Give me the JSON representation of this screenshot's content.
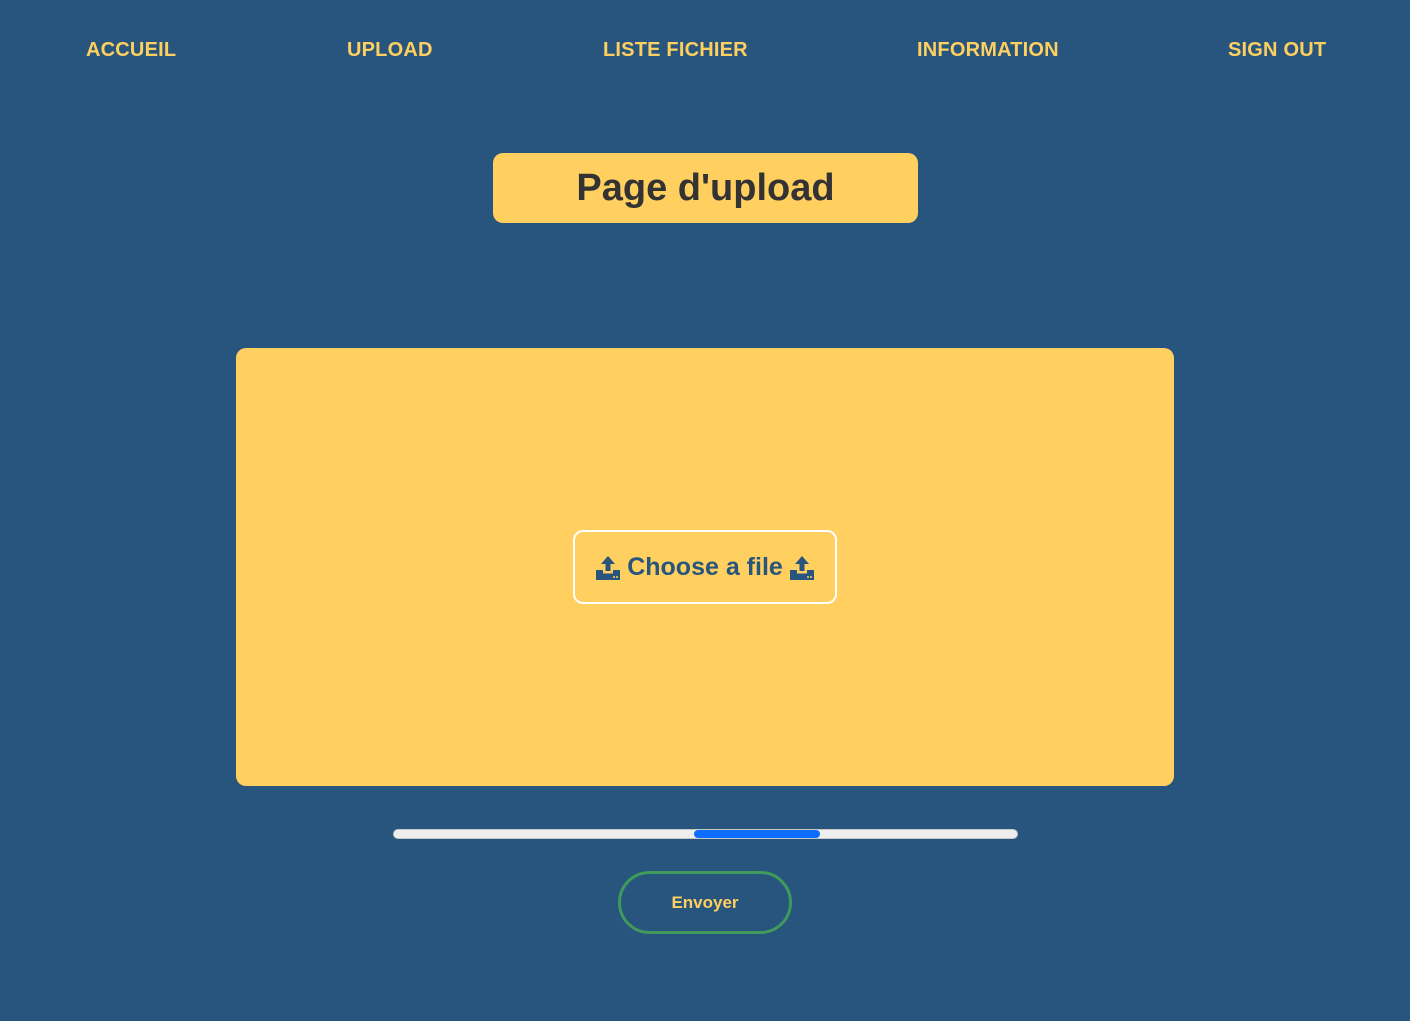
{
  "nav": {
    "items": [
      {
        "label": "ACCUEIL"
      },
      {
        "label": "UPLOAD"
      },
      {
        "label": "LISTE FICHIER"
      },
      {
        "label": "INFORMATION"
      },
      {
        "label": "SIGN OUT"
      }
    ]
  },
  "title": "Page d'upload",
  "upload": {
    "choose_label": "Choose a file",
    "icon_left": "upload-icon",
    "icon_right": "upload-icon"
  },
  "progress": {
    "indeterminate": true
  },
  "send_label": "Envoyer",
  "colors": {
    "background": "#27557d",
    "accent": "#ffcf5f",
    "title_text": "#333333",
    "progress_fill": "#0d6efd",
    "button_border": "#3f9a5c"
  }
}
